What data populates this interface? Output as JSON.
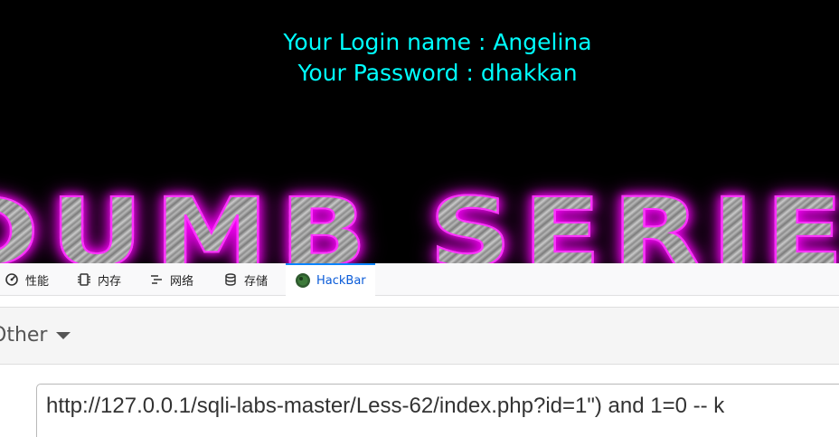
{
  "page": {
    "login_label": "Your Login name : Angelina",
    "password_label": "Your Password : dhakkan",
    "banner_text": "DUMB SERIES",
    "colors": {
      "login_text": "#00ffff",
      "banner_glow": "#ff00ff",
      "background": "#000000"
    }
  },
  "devtools": {
    "tabs": [
      {
        "label": "性能",
        "icon": "performance-gauge-icon"
      },
      {
        "label": "内存",
        "icon": "memory-chip-icon"
      },
      {
        "label": "网络",
        "icon": "network-lines-icon"
      },
      {
        "label": "存储",
        "icon": "storage-database-icon"
      },
      {
        "label": "HackBar",
        "icon": "hackbar-logo-icon",
        "active": true
      }
    ],
    "toolbar": {
      "dropdown_label": "Other"
    },
    "url_value": "http://127.0.0.1/sqli-labs-master/Less-62/index.php?id=1\") and 1=0 -- k",
    "colors": {
      "active_tab": "#0a84ff"
    }
  }
}
